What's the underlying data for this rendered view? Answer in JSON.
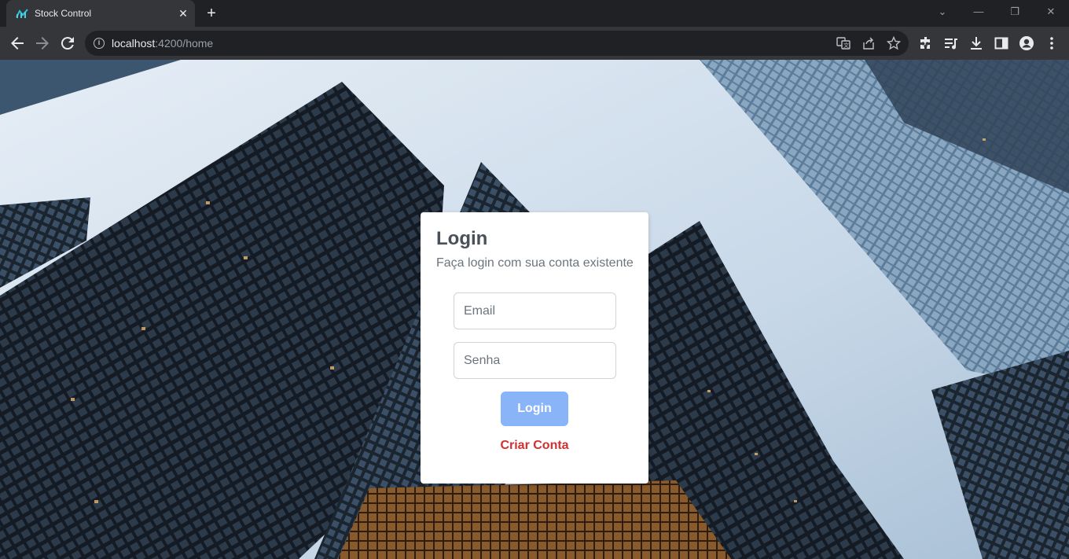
{
  "browser": {
    "tab": {
      "title": "Stock Control",
      "favicon": "chart-favicon-icon"
    },
    "url": {
      "host": "localhost",
      "path": ":4200/home"
    },
    "colors": {
      "chrome_dark": "#202124",
      "chrome_toolbar": "#35363a"
    }
  },
  "login": {
    "title": "Login",
    "subtitle": "Faça login com sua conta existente",
    "email_placeholder": "Email",
    "password_placeholder": "Senha",
    "submit_label": "Login",
    "create_account_label": "Criar Conta",
    "colors": {
      "button": "#8ab4f8",
      "link": "#d32f2f"
    }
  }
}
